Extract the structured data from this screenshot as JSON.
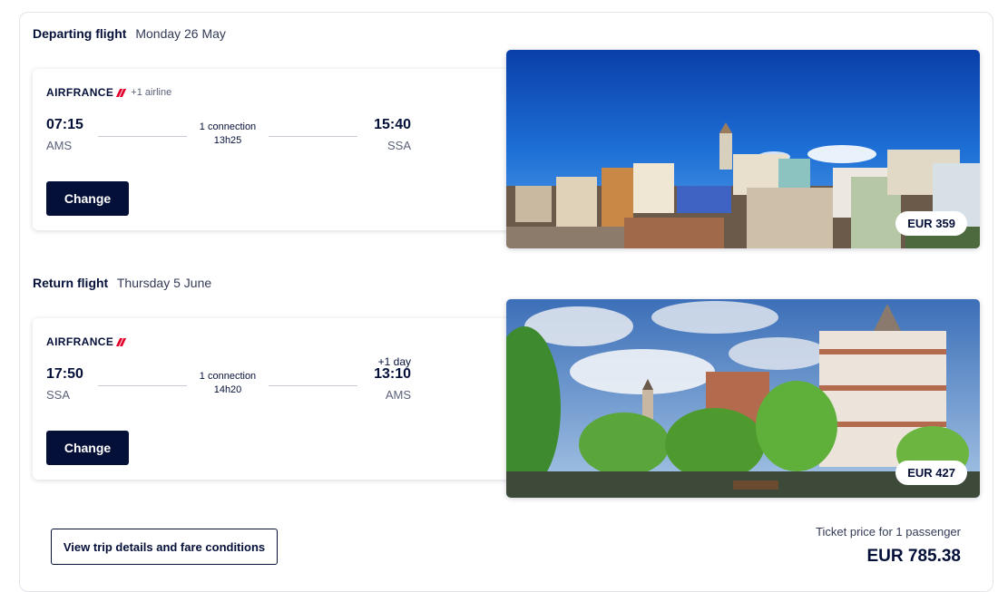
{
  "departing": {
    "heading": "Departing flight",
    "date": "Monday 26 May",
    "airline": "AIRFRANCE",
    "extra_airline": "+1 airline",
    "dep_time": "07:15",
    "dep_code": "AMS",
    "arr_time": "15:40",
    "arr_code": "SSA",
    "connection": "1 connection",
    "duration": "13h25",
    "change_label": "Change",
    "price": "EUR 359"
  },
  "return": {
    "heading": "Return flight",
    "date": "Thursday 5 June",
    "airline": "AIRFRANCE",
    "plus_day": "+1 day",
    "dep_time": "17:50",
    "dep_code": "SSA",
    "arr_time": "13:10",
    "arr_code": "AMS",
    "connection": "1 connection",
    "duration": "14h20",
    "change_label": "Change",
    "price": "EUR 427"
  },
  "footer": {
    "details_label": "View trip details and fare conditions",
    "ticket_label": "Ticket price for 1 passenger",
    "total": "EUR 785.38"
  },
  "colors": {
    "brand_navy": "#051039",
    "airfrance_red": "#e4002b"
  }
}
